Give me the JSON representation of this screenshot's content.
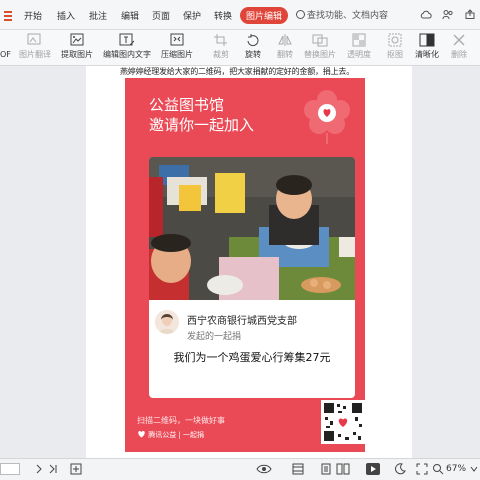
{
  "tabs": [
    {
      "label": "开始"
    },
    {
      "label": "插入"
    },
    {
      "label": "批注"
    },
    {
      "label": "编辑"
    },
    {
      "label": "页面"
    },
    {
      "label": "保护"
    },
    {
      "label": "转换"
    },
    {
      "label": "图片编辑",
      "active": true
    }
  ],
  "search": {
    "text": "查找功能、文档内容"
  },
  "ribbon": [
    {
      "label": "图片翻译",
      "icon": "translate-image-icon",
      "disabled": true
    },
    {
      "label": "提取图片",
      "icon": "extract-image-icon",
      "disabled": false
    },
    {
      "label": "编辑图内文字",
      "icon": "edit-image-text-icon",
      "disabled": false
    },
    {
      "label": "压缩图片",
      "icon": "compress-image-icon",
      "disabled": false
    },
    {
      "label": "裁剪",
      "icon": "crop-icon",
      "disabled": true
    },
    {
      "label": "旋转",
      "icon": "rotate-icon",
      "disabled": false
    },
    {
      "label": "翻转",
      "icon": "flip-icon",
      "disabled": true
    },
    {
      "label": "替换图片",
      "icon": "replace-image-icon",
      "disabled": true
    },
    {
      "label": "透明度",
      "icon": "transparency-icon",
      "disabled": true
    },
    {
      "label": "抠图",
      "icon": "cutout-icon",
      "disabled": true
    },
    {
      "label": "清晰化",
      "icon": "sharpen-icon",
      "disabled": false
    },
    {
      "label": "删除",
      "icon": "delete-icon",
      "disabled": true
    }
  ],
  "ribbon_left_partial": "OF",
  "document": {
    "intro_text": "燕婷婷经理发给大家的二维码，把大家捐献的定好的金额，捐上去。"
  },
  "poster": {
    "title_line1": "公益图书馆",
    "title_line2": "邀请你一起加入",
    "org_name": "西宁农商银行城西党支部",
    "org_sub": "发起的一起捐",
    "campaign_title": "我们为一个鸡蛋爱心行筹集27元",
    "footer_slogan": "扫描二维码，一块做好事",
    "footer_logo": "腾讯公益 | 一起捐",
    "brand_color": "#ea4a56"
  },
  "statusbar": {
    "zoom": "67%"
  },
  "colors": {
    "accent": "#e0453a"
  }
}
